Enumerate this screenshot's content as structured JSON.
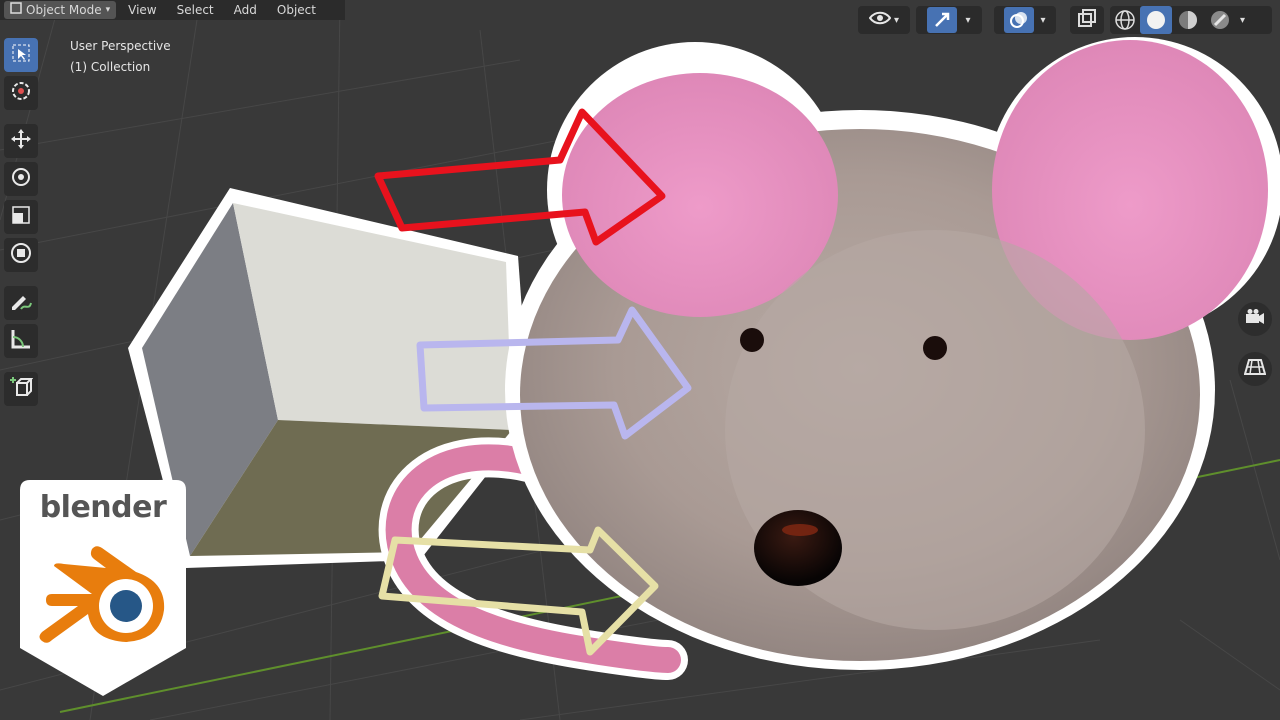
{
  "header": {
    "mode": "Object Mode",
    "menu": [
      "View",
      "Select",
      "Add",
      "Object"
    ]
  },
  "overlay": {
    "perspective": "User Perspective",
    "collection": "(1) Collection"
  },
  "logo": {
    "text": "blender",
    "brand_orange": "#e87d0d",
    "brand_blue": "#265787"
  },
  "colors": {
    "viewport_bg": "#393939",
    "active_tool": "#4772b3",
    "arrow_red": "#e8121d",
    "arrow_lavender": "#b9b6ee",
    "arrow_yellow": "#e6e0a6",
    "mouse_ear": "#e99bc6"
  },
  "icons": {
    "toolbar": [
      "select-box-icon",
      "cursor-icon",
      "move-icon",
      "rotate-icon",
      "scale-icon",
      "transform-icon",
      "annotate-icon",
      "measure-icon",
      "add-cube-icon"
    ],
    "right_side": [
      "camera-icon",
      "grid-view-icon"
    ]
  }
}
